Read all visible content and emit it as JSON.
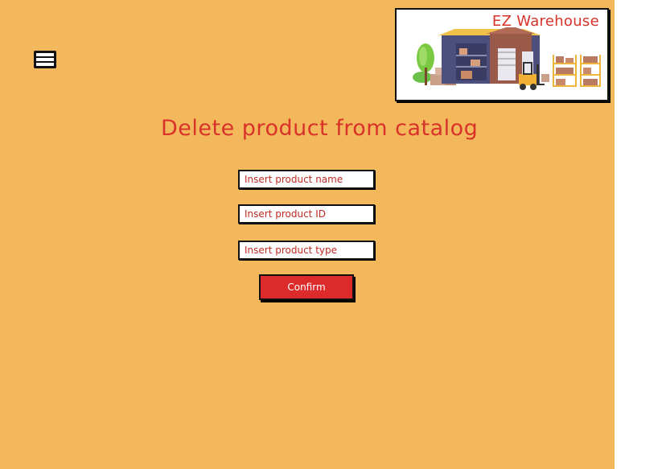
{
  "logo": {
    "title": "EZ Warehouse",
    "image": "warehouse-illustration"
  },
  "menu": {
    "icon": "hamburger-menu-icon"
  },
  "page": {
    "title": "Delete product from catalog"
  },
  "form": {
    "product_name": {
      "placeholder": "Insert product name",
      "value": ""
    },
    "product_id": {
      "placeholder": "Insert product ID",
      "value": ""
    },
    "product_type": {
      "placeholder": "Insert product type",
      "value": ""
    },
    "confirm_label": "Confirm"
  },
  "colors": {
    "background": "#f4b85c",
    "accent": "#d8322a",
    "button": "#dd2a2a"
  }
}
